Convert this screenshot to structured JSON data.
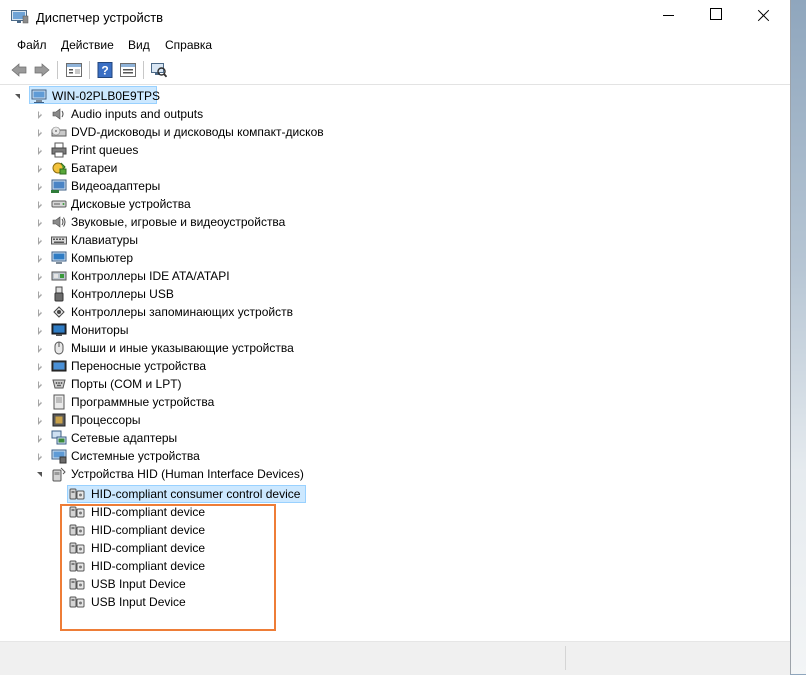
{
  "window": {
    "title": "Диспетчер устройств"
  },
  "menu": [
    "Файл",
    "Действие",
    "Вид",
    "Справка"
  ],
  "toolbar": [
    "back-icon",
    "forward-icon",
    "properties-icon",
    "help-icon",
    "details-icon",
    "scan-hardware-icon"
  ],
  "tree": {
    "root": "WIN-02PLB0E9TPS",
    "categories": [
      {
        "label": "Audio inputs and outputs",
        "icon": "speaker-icon"
      },
      {
        "label": "DVD-дисководы и дисководы компакт-дисков",
        "icon": "dvd-drive-icon"
      },
      {
        "label": "Print queues",
        "icon": "printer-icon"
      },
      {
        "label": "Батареи",
        "icon": "battery-icon"
      },
      {
        "label": "Видеоадаптеры",
        "icon": "display-adapter-icon"
      },
      {
        "label": "Дисковые устройства",
        "icon": "disk-drive-icon"
      },
      {
        "label": "Звуковые, игровые и видеоустройства",
        "icon": "sound-icon"
      },
      {
        "label": "Клавиатуры",
        "icon": "keyboard-icon"
      },
      {
        "label": "Компьютер",
        "icon": "computer-icon"
      },
      {
        "label": "Контроллеры IDE ATA/ATAPI",
        "icon": "ide-controller-icon"
      },
      {
        "label": "Контроллеры USB",
        "icon": "usb-icon"
      },
      {
        "label": "Контроллеры запоминающих устройств",
        "icon": "storage-controller-icon"
      },
      {
        "label": "Мониторы",
        "icon": "monitor-icon"
      },
      {
        "label": "Мыши и иные указывающие устройства",
        "icon": "mouse-icon"
      },
      {
        "label": "Переносные устройства",
        "icon": "portable-device-icon"
      },
      {
        "label": "Порты (COM и LPT)",
        "icon": "port-icon"
      },
      {
        "label": "Программные устройства",
        "icon": "software-device-icon"
      },
      {
        "label": "Процессоры",
        "icon": "processor-icon"
      },
      {
        "label": "Сетевые адаптеры",
        "icon": "network-adapter-icon"
      },
      {
        "label": "Системные устройства",
        "icon": "system-device-icon"
      },
      {
        "label": "Устройства HID (Human Interface Devices)",
        "icon": "hid-icon"
      }
    ],
    "hid_children": [
      "HID-compliant consumer control device",
      "HID-compliant device",
      "HID-compliant device",
      "HID-compliant device",
      "HID-compliant device",
      "USB Input Device",
      "USB Input Device"
    ]
  },
  "colors": {
    "selection_bg": "#cce8ff",
    "selection_border": "#99d1ff",
    "annotation_box": "#ee7d37"
  }
}
